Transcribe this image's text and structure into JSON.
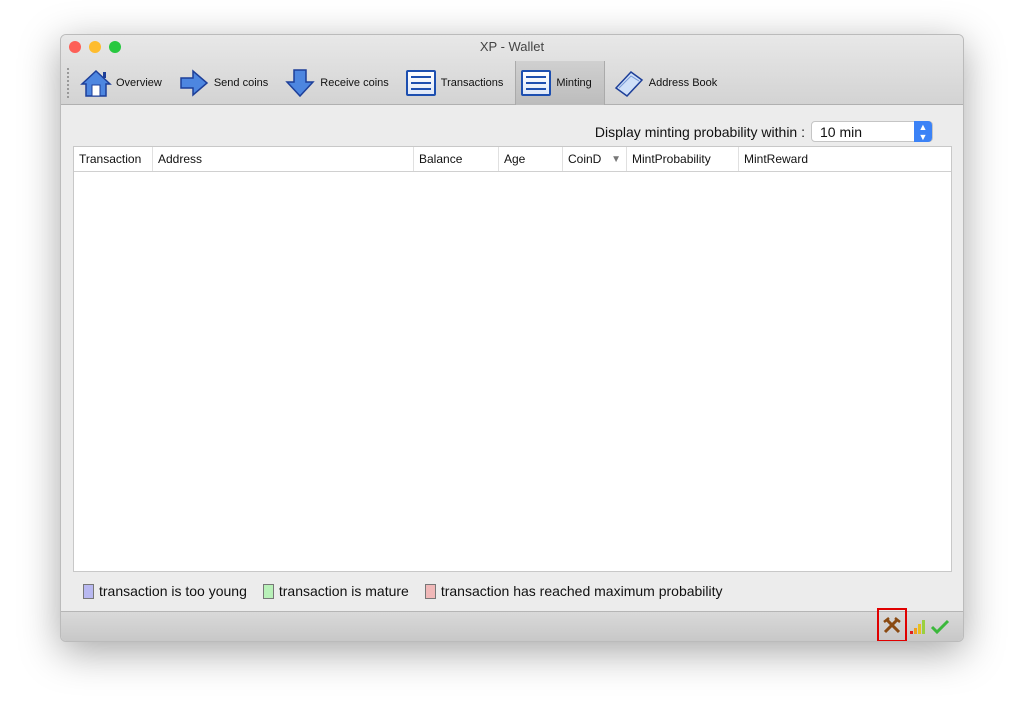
{
  "window": {
    "title": "XP - Wallet"
  },
  "toolbar": {
    "items": [
      {
        "label": "Overview",
        "icon": "home-icon"
      },
      {
        "label": "Send coins",
        "icon": "arrow-right-icon"
      },
      {
        "label": "Receive coins",
        "icon": "arrow-down-icon"
      },
      {
        "label": "Transactions",
        "icon": "list-icon"
      },
      {
        "label": "Minting",
        "icon": "list-icon",
        "active": true
      },
      {
        "label": "Address Book",
        "icon": "book-icon"
      }
    ]
  },
  "filter": {
    "label": "Display minting probability within :",
    "value": "10 min"
  },
  "table": {
    "columns": [
      "Transaction",
      "Address",
      "Balance",
      "Age",
      "CoinD",
      "MintProbability",
      "MintReward"
    ],
    "sort_column": "CoinD",
    "sort_direction": "descending",
    "rows": []
  },
  "legend": [
    {
      "label": "transaction is too young",
      "color": "#b8b8f0"
    },
    {
      "label": "transaction is mature",
      "color": "#b8f0b8"
    },
    {
      "label": "transaction has reached maximum probability",
      "color": "#f0b8b8"
    }
  ],
  "status": {
    "icons": [
      "mining-icon",
      "signal-strength-icon",
      "synced-check-icon"
    ],
    "highlight_color": "#e00000"
  }
}
